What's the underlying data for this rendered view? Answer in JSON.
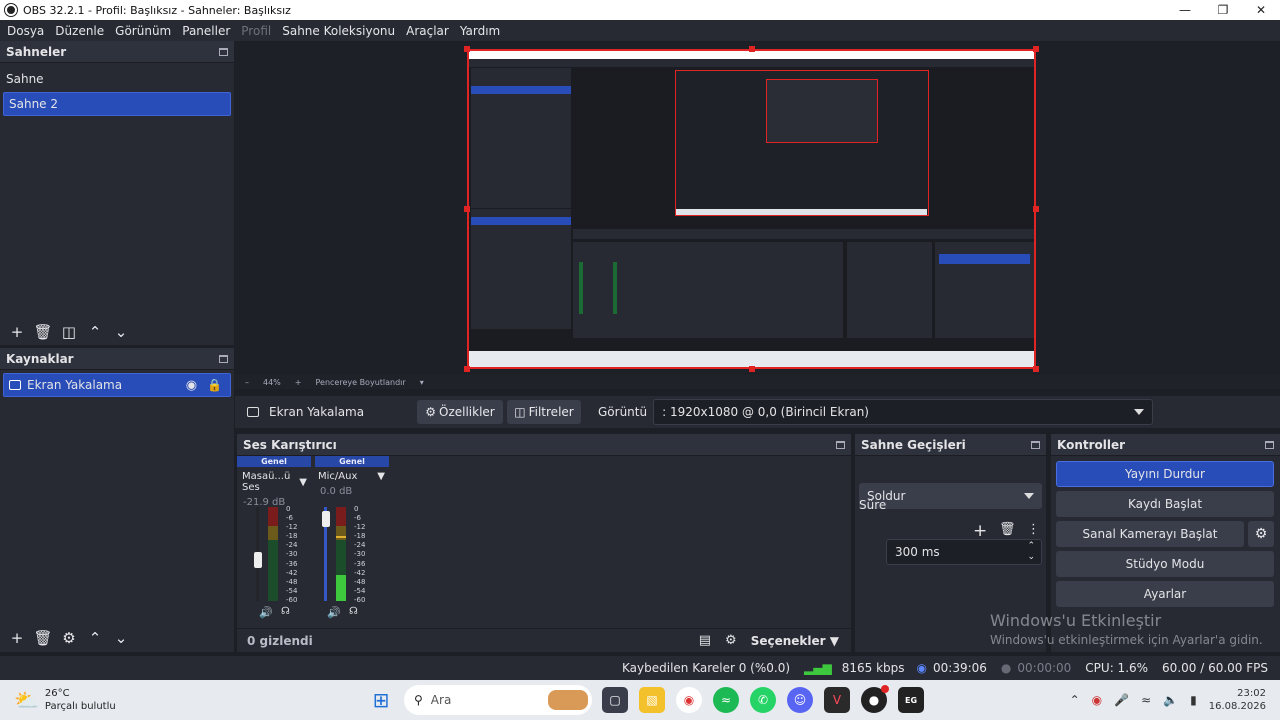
{
  "window": {
    "title": "OBS 32.2.1 - Profil: Başlıksız - Sahneler: Başlıksız"
  },
  "menu": [
    "Dosya",
    "Düzenle",
    "Görünüm",
    "Paneller",
    "Profil",
    "Sahne Koleksiyonu",
    "Araçlar",
    "Yardım"
  ],
  "scenes": {
    "header": "Sahneler",
    "items": [
      "Sahne",
      "Sahne 2"
    ],
    "selected": "Sahne 2"
  },
  "sources": {
    "header": "Kaynaklar",
    "items": [
      "Ekran Yakalama"
    ]
  },
  "preview": {
    "zoom": "44%",
    "fit_label": "Pencereye Boyutlandır"
  },
  "source_bar": {
    "name": "Ekran Yakalama",
    "properties": "Özellikler",
    "filters": "Filtreler",
    "display_label": "Görüntü",
    "display_value": ": 1920x1080 @ 0,0 (Birincil Ekran)"
  },
  "mixer": {
    "header": "Ses Karıştırıcı",
    "channels": [
      {
        "group": "Genel",
        "name": "Masaü...ü Ses",
        "db": "-21.9 dB",
        "volume": 0.42,
        "level": 0.0
      },
      {
        "group": "Genel",
        "name": "Mic/Aux",
        "db": "0.0 dB",
        "volume": 0.95,
        "level": 0.28
      }
    ],
    "scale": [
      "0",
      "-6",
      "-12",
      "-18",
      "-24",
      "-30",
      "-36",
      "-42",
      "-48",
      "-54",
      "-60"
    ],
    "hidden": "0 gizlendi",
    "options": "Seçenekler"
  },
  "transitions": {
    "header": "Sahne Geçişleri",
    "type": "Soldur",
    "duration_label": "Süre",
    "duration": "300 ms"
  },
  "controls": {
    "header": "Kontroller",
    "buttons": [
      "Yayını Durdur",
      "Kaydı Başlat",
      "Sanal Kamerayı Başlat",
      "Stüdyo Modu",
      "Ayarlar"
    ]
  },
  "watermark": {
    "title": "Windows'u Etkinleştir",
    "sub": "Windows'u etkinleştirmek için Ayarlar'a gidin."
  },
  "status": {
    "dropped": "Kaybedilen Kareler 0 (%0.0)",
    "kbps": "8165 kbps",
    "stream_time": "00:39:06",
    "rec_time": "00:00:00",
    "cpu": "CPU: 1.6%",
    "fps": "60.00 / 60.00 FPS"
  },
  "taskbar": {
    "temp": "26°C",
    "weather": "Parçalı bulutlu",
    "search": "Ara",
    "time": "23:02",
    "date": "16.08.2026"
  },
  "colors": {
    "accent": "#284cb8",
    "recording_red": "#e02424"
  }
}
